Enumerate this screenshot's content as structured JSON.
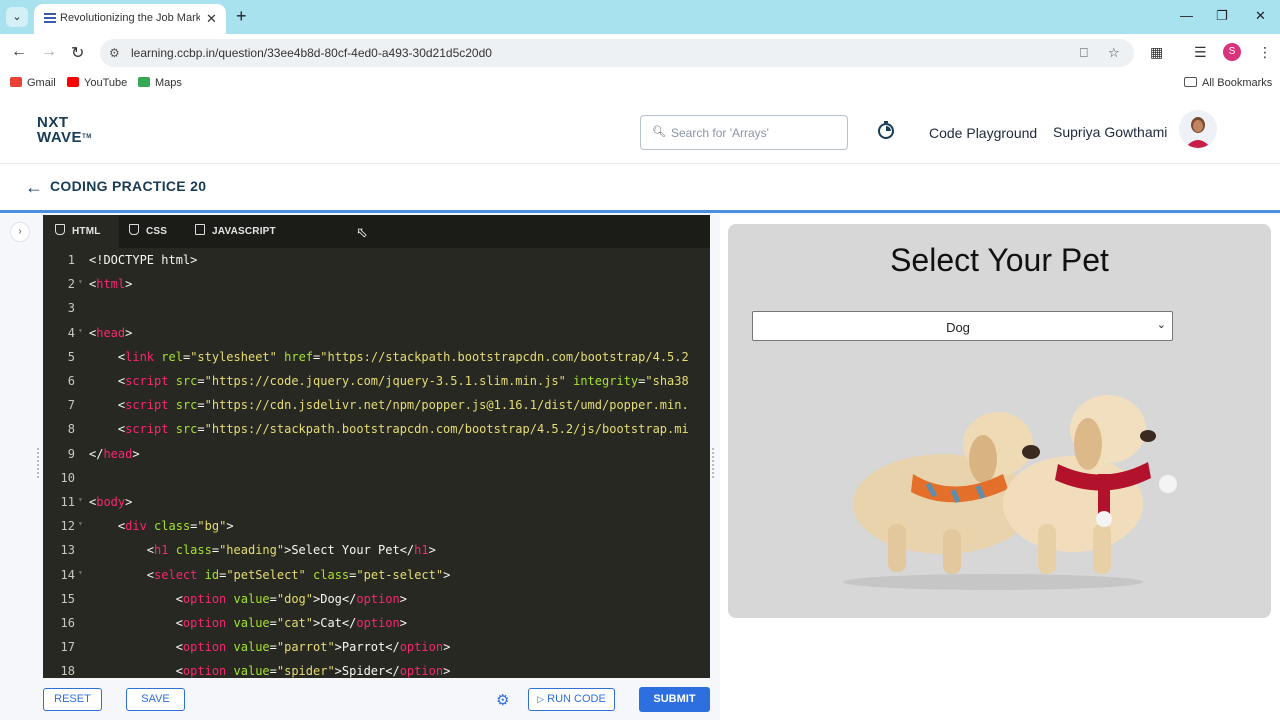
{
  "browser": {
    "tab_title": "Revolutionizing the Job Market",
    "url": "learning.ccbp.in/question/33ee4b8d-80cf-4ed0-a493-30d21d5c20d0",
    "profile_initial": "S",
    "bookmarks": [
      {
        "label": "Gmail"
      },
      {
        "label": "YouTube"
      },
      {
        "label": "Maps"
      }
    ],
    "all_bookmarks": "All Bookmarks"
  },
  "site": {
    "logo_line1": "NXT",
    "logo_line2": "WAVE",
    "logo_tm": "TM",
    "search_placeholder": "Search for 'Arrays'",
    "code_playground": "Code Playground",
    "username": "Supriya Gowthami",
    "practice_title": "CODING PRACTICE 20"
  },
  "editor": {
    "tabs": [
      {
        "label": "HTML",
        "active": true
      },
      {
        "label": "CSS",
        "active": false
      },
      {
        "label": "JAVASCRIPT",
        "active": false
      }
    ],
    "lines": [
      {
        "n": "1",
        "text": "<!DOCTYPE html>"
      },
      {
        "n": "2",
        "text": "<html>"
      },
      {
        "n": "3",
        "text": ""
      },
      {
        "n": "4",
        "text": "<head>"
      },
      {
        "n": "5",
        "text": "    <link rel=\"stylesheet\" href=\"https://stackpath.bootstrapcdn.com/bootstrap/4.5.2"
      },
      {
        "n": "6",
        "text": "    <script src=\"https://code.jquery.com/jquery-3.5.1.slim.min.js\" integrity=\"sha38"
      },
      {
        "n": "7",
        "text": "    <script src=\"https://cdn.jsdelivr.net/npm/popper.js@1.16.1/dist/umd/popper.min."
      },
      {
        "n": "8",
        "text": "    <script src=\"https://stackpath.bootstrapcdn.com/bootstrap/4.5.2/js/bootstrap.mi"
      },
      {
        "n": "9",
        "text": "</head>"
      },
      {
        "n": "10",
        "text": ""
      },
      {
        "n": "11",
        "text": "<body>"
      },
      {
        "n": "12",
        "text": "    <div class=\"bg\">"
      },
      {
        "n": "13",
        "text": "        <h1 class=\"heading\">Select Your Pet</h1>"
      },
      {
        "n": "14",
        "text": "        <select id=\"petSelect\" class=\"pet-select\">"
      },
      {
        "n": "15",
        "text": "            <option value=\"dog\">Dog</option>"
      },
      {
        "n": "16",
        "text": "            <option value=\"cat\">Cat</option>"
      },
      {
        "n": "17",
        "text": "            <option value=\"parrot\">Parrot</option>"
      },
      {
        "n": "18",
        "text": "            <option value=\"spider\">Spider</option>"
      }
    ],
    "buttons": {
      "reset": "RESET",
      "save": "SAVE",
      "run": "RUN CODE",
      "submit": "SUBMIT"
    }
  },
  "preview": {
    "heading": "Select Your Pet",
    "selected": "Dog"
  },
  "colors": {
    "accent": "#2e6fe0",
    "editor_bg": "#272822",
    "tag": "#f92672",
    "attr": "#a6e22e",
    "string": "#e6db74"
  }
}
